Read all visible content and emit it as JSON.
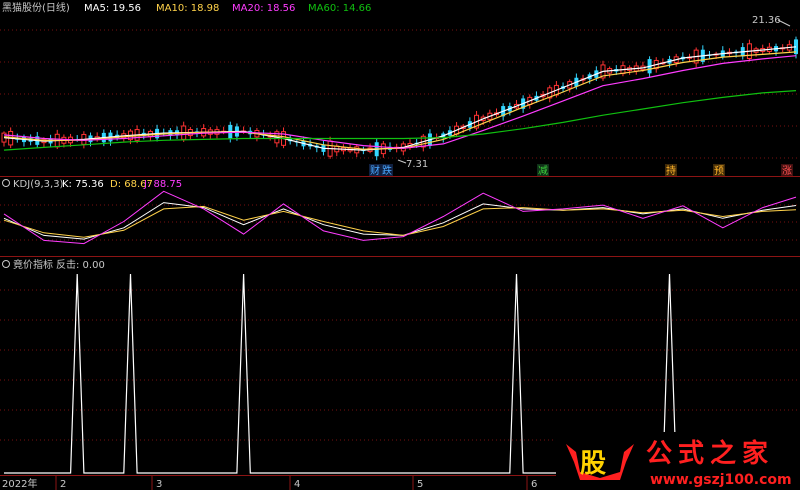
{
  "colors": {
    "background": "#000000",
    "grid": "#7a1010",
    "separator": "#8c1414",
    "text": "#c8c8c8",
    "ma5": "#ffffff",
    "ma10": "#ffd24a",
    "ma20": "#ff3cff",
    "ma60": "#10c010",
    "candle_up": "#ff3333",
    "candle_down": "#33d6ff",
    "k": "#ffffff",
    "d": "#ffd24a",
    "j": "#ff3cff",
    "signal": "#ffffff",
    "watermark_red": "#ff2020",
    "watermark_yellow": "#ffd200"
  },
  "main_panel": {
    "title": "黑猫股份(日线)",
    "ma5_label": "MA5: 19.56",
    "ma10_label": "MA10: 18.98",
    "ma20_label": "MA20: 18.56",
    "ma60_label": "MA60: 14.66",
    "high_annotation": "21.36",
    "low_annotation": "7.31",
    "event_markers": [
      "财",
      "跌",
      "减",
      "持",
      "预",
      "涨"
    ]
  },
  "kdj_panel": {
    "title": "KDJ(9,3,3)",
    "k_label": "K: 75.36",
    "d_label": "D: 68.67",
    "j_label": "J: 88.75"
  },
  "signal_panel": {
    "title": "竟价指标",
    "value_label": "反击: 0.00"
  },
  "x_axis": {
    "labels": [
      "2022年",
      "2",
      "3",
      "4",
      "5",
      "6"
    ]
  },
  "watermark": {
    "logo_char": "股",
    "text": "公式之家",
    "url": "www.gszj100.com"
  },
  "chart_data": [
    {
      "type": "line",
      "title": "黑猫股份(日线)",
      "x_unit": "trading day index",
      "y_unit": "price",
      "ylim": [
        6,
        23
      ],
      "x": [
        0,
        6,
        12,
        18,
        24,
        30,
        36,
        42,
        48,
        54,
        60,
        66,
        72,
        78,
        84,
        90,
        96,
        102,
        108,
        114,
        119
      ],
      "series": [
        {
          "name": "MA5",
          "values": [
            9.4,
            9.0,
            9.2,
            9.6,
            9.9,
            10.0,
            10.1,
            9.3,
            8.2,
            8.0,
            8.3,
            9.6,
            11.5,
            13.2,
            15.0,
            16.8,
            17.2,
            18.3,
            18.8,
            19.2,
            19.56
          ]
        },
        {
          "name": "MA10",
          "values": [
            9.5,
            9.1,
            9.1,
            9.5,
            9.8,
            10.0,
            10.0,
            9.5,
            8.6,
            8.1,
            8.2,
            9.2,
            11.0,
            12.8,
            14.5,
            16.3,
            16.9,
            17.8,
            18.4,
            18.7,
            18.98
          ]
        },
        {
          "name": "MA20",
          "values": [
            9.7,
            9.3,
            9.1,
            9.3,
            9.6,
            9.9,
            10.0,
            9.8,
            9.1,
            8.5,
            8.2,
            8.7,
            10.2,
            11.8,
            13.5,
            15.2,
            16.0,
            16.9,
            17.7,
            18.2,
            18.56
          ]
        },
        {
          "name": "MA60",
          "values": [
            8.0,
            8.3,
            8.6,
            8.9,
            9.1,
            9.2,
            9.3,
            9.3,
            9.3,
            9.3,
            9.3,
            9.4,
            9.8,
            10.4,
            11.1,
            11.9,
            12.6,
            13.3,
            13.9,
            14.4,
            14.66
          ]
        }
      ],
      "annotations": [
        {
          "text": "21.36",
          "x": 118,
          "y": 21.36
        },
        {
          "text": "7.31",
          "x": 61,
          "y": 7.31
        }
      ]
    },
    {
      "type": "line",
      "title": "KDJ(9,3,3)",
      "ylim": [
        0,
        100
      ],
      "x": [
        0,
        6,
        12,
        18,
        24,
        30,
        36,
        42,
        48,
        54,
        60,
        66,
        72,
        78,
        84,
        90,
        96,
        102,
        108,
        114,
        119
      ],
      "series": [
        {
          "name": "K",
          "values": [
            55,
            28,
            22,
            40,
            80,
            72,
            45,
            70,
            45,
            30,
            28,
            48,
            78,
            70,
            68,
            72,
            62,
            70,
            55,
            68,
            75.36
          ]
        },
        {
          "name": "D",
          "values": [
            52,
            32,
            25,
            36,
            70,
            74,
            52,
            66,
            50,
            35,
            28,
            42,
            70,
            72,
            68,
            70,
            64,
            68,
            58,
            66,
            68.67
          ]
        },
        {
          "name": "J",
          "values": [
            62,
            20,
            15,
            50,
            98,
            70,
            30,
            78,
            35,
            20,
            26,
            58,
            95,
            66,
            70,
            76,
            55,
            75,
            40,
            72,
            88.75
          ]
        }
      ]
    },
    {
      "type": "line",
      "title": "竟价指标",
      "ylim": [
        0,
        1
      ],
      "x": [
        0,
        10,
        11,
        12,
        18,
        19,
        20,
        35,
        36,
        37,
        76,
        77,
        78,
        99,
        100,
        101,
        119
      ],
      "series": [
        {
          "name": "反击",
          "values": [
            0,
            0,
            1,
            0,
            0,
            1,
            0,
            0,
            1,
            0,
            0,
            1,
            0,
            0,
            1,
            0,
            0
          ]
        }
      ]
    }
  ]
}
